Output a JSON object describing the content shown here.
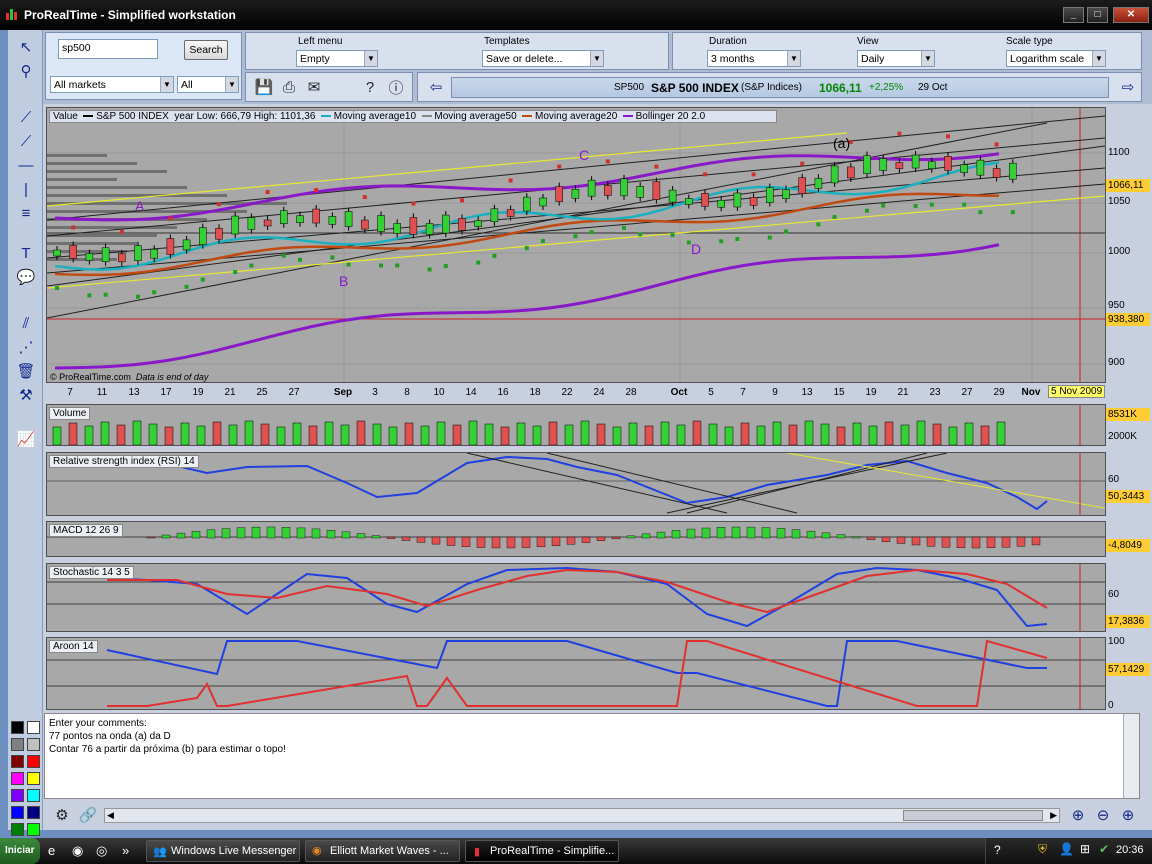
{
  "window": {
    "title": "ProRealTime - Simplified workstation",
    "buttons": [
      "_",
      "□",
      "✕"
    ]
  },
  "search": {
    "value": "sp500",
    "button": "Search"
  },
  "filters": {
    "market": "All markets",
    "type": "All"
  },
  "left_menu": {
    "label": "Left menu",
    "value": "Empty"
  },
  "templates": {
    "label": "Templates",
    "value": "Save or delete..."
  },
  "duration": {
    "label": "Duration",
    "value": "3 months"
  },
  "view": {
    "label": "View",
    "value": "Daily"
  },
  "scale": {
    "label": "Scale type",
    "value": "Logarithm scale"
  },
  "quote": {
    "ticker": "SP500",
    "name": "S&P 500 INDEX",
    "market": "(S&P Indices)",
    "price": "1066,11",
    "change": "+2,25%",
    "date": "29 Oct"
  },
  "main_chart": {
    "legend": {
      "value": "Value",
      "series": "S&P 500 INDEX",
      "range": "year Low: 666,79 High: 1101,36",
      "ma10": "Moving average10",
      "ma50": "Moving average50",
      "ma20": "Moving average20",
      "bb": "Bollinger 20 2.0"
    },
    "annotations": {
      "a": "A",
      "b": "B",
      "c": "C",
      "d": "D",
      "wave_a": "(a)"
    },
    "copyright": "© ProRealTime.com",
    "eod": "Data is end of day",
    "price_ticks": [
      "1100",
      "1050",
      "1000",
      "950",
      "900"
    ],
    "last_price": "1066,11",
    "hline": "938,380",
    "date_ticks": [
      "7",
      "11",
      "13",
      "17",
      "19",
      "21",
      "25",
      "27",
      "Sep",
      "3",
      "8",
      "10",
      "14",
      "16",
      "18",
      "22",
      "24",
      "28",
      "Oct",
      "5",
      "7",
      "9",
      "13",
      "15",
      "19",
      "21",
      "23",
      "27",
      "29",
      "Nov"
    ],
    "cursor_date": "5 Nov 2009"
  },
  "volume": {
    "label": "Volume",
    "value": "8531K",
    "tick": "2000K"
  },
  "rsi": {
    "label": "Relative strength index (RSI) 14",
    "tick": "60",
    "value": "50,3443"
  },
  "macd": {
    "label": "MACD 12 26 9",
    "value": "-4,8049"
  },
  "stochastic": {
    "label": "Stochastic 14 3 5",
    "tick": "60",
    "value": "17,3836"
  },
  "aroon": {
    "label": "Aroon 14",
    "tick_top": "100",
    "value": "57,1429",
    "tick_bottom": "0"
  },
  "comments": {
    "line1": "Enter your comments:",
    "line2": "77 pontos na onda (a) da D",
    "line3": "Contar 76 a partir da próxima (b) para estimar o topo!"
  },
  "colors": {
    "green": "#35d035",
    "red": "#e05050",
    "ma10": "#1ab0c0",
    "ma20": "#c04a10",
    "bollinger": "#8a18c8",
    "trend": "#e8e830"
  },
  "taskbar": {
    "start": "Iniciar",
    "tasks": [
      "Windows Live Messenger",
      "Elliott Market Waves - ...",
      "ProRealTime - Simplifie..."
    ],
    "clock": "20:36"
  }
}
